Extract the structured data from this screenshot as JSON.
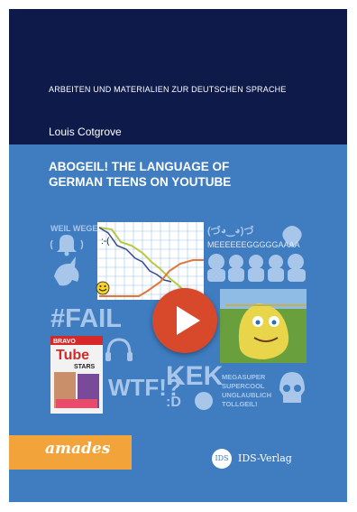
{
  "cover": {
    "series": "ARBEITEN UND MATERIALIEN ZUR DEUTSCHEN SPRACHE",
    "author": "Louis Cotgrove",
    "title_line1": "ABOGEIL! THE LANGUAGE OF",
    "title_line2": "GERMAN TEENS ON YOUTUBE",
    "publisher_imprint": "amades",
    "publisher_logo": "IDS",
    "publisher_name": "IDS-Verlag",
    "colors": {
      "top_band": "#0e1a4a",
      "main": "#3f7cc0",
      "imprint_bar": "#f2a33a",
      "play_button": "#d8492b"
    }
  },
  "collage": {
    "words_weil": "WEIL WEGEN",
    "chart_emoticon": ":-(",
    "kaomoji": "(づ◕‿◕)づ",
    "long_word": "MEEEEEEGGGGGAAAA",
    "hashtag": "#FAIL",
    "magazine_brand": "BRAVO",
    "magazine_title": "Tube",
    "magazine_sub": "STARS",
    "wtf": "WTF!?",
    "kek": "KEK",
    "smiley": ":D",
    "mega1": "MEGASUPER",
    "mega2": "SUPERCOOL",
    "mega3": "UNGLAUBLICH",
    "mega4": "TOLLGEIL!"
  }
}
